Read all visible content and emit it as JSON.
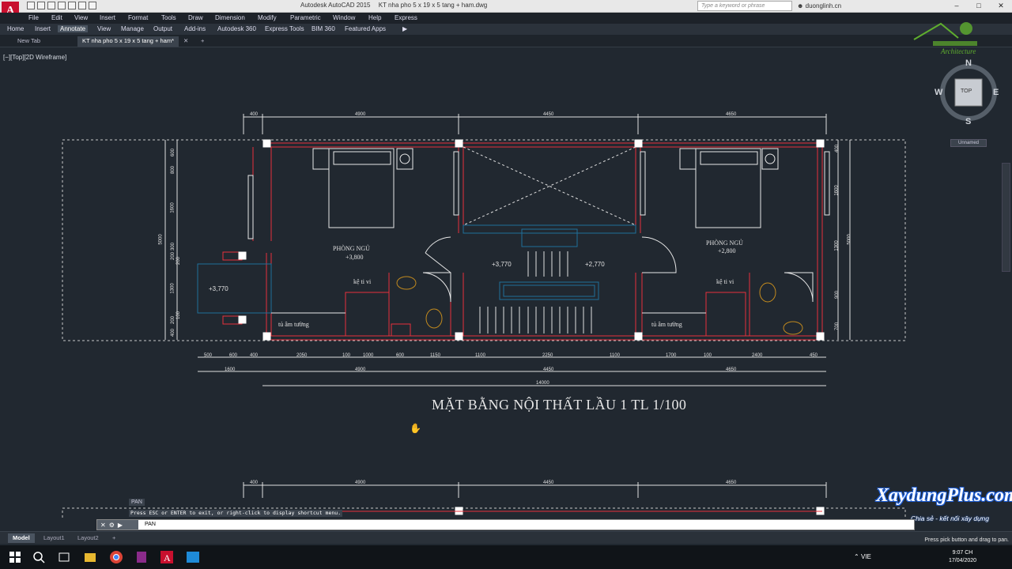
{
  "titlebar": {
    "app": "Autodesk AutoCAD 2015",
    "file": "KT nha pho 5 x 19 x 5 tang + ham.dwg",
    "search_placeholder": "Type a keyword or phrase",
    "user": "duonglinh.cn"
  },
  "app_logo": "A",
  "menu": [
    "File",
    "Edit",
    "View",
    "Insert",
    "Format",
    "Tools",
    "Draw",
    "Dimension",
    "Modify",
    "Parametric",
    "Window",
    "Help",
    "Express"
  ],
  "ribbon_tabs": [
    "Home",
    "Insert",
    "Annotate",
    "View",
    "Manage",
    "Output",
    "Add-ins",
    "Autodesk 360",
    "Express Tools",
    "BIM 360",
    "Featured Apps"
  ],
  "ribbon_active": "Annotate",
  "file_tabs": [
    "New Tab",
    "KT nha pho 5 x 19 x 5 tang + ham*"
  ],
  "viewport_label": "[−][Top][2D Wireframe]",
  "viewcube": {
    "north": "N",
    "south": "S",
    "east": "E",
    "west": "W",
    "face": "TOP",
    "ucs": "Unnamed"
  },
  "drawing": {
    "title": "MẶT BẰNG NỘI THẤT LẦU 1 TL 1/100",
    "rooms": {
      "bedroom_left": "PHÒNG NGỦ",
      "bedroom_left_level": "+3,800",
      "bedroom_right": "PHÒNG NGỦ",
      "bedroom_right_level": "+2,800",
      "balcony_level": "+3,770",
      "stair_level_left": "+3,770",
      "stair_level_right": "+2,770",
      "tv_shelf_left": "kệ ti vi",
      "tv_shelf_right": "kệ ti vi",
      "wardrobe_left": "tủ âm tường",
      "wardrobe_right": "tủ âm tường"
    },
    "dims_top": [
      "400",
      "4900",
      "4450",
      "4650"
    ],
    "dims_bottom_1": [
      "500",
      "600",
      "400",
      "2050",
      "100",
      "1000",
      "600",
      "1150",
      "1100",
      "2250",
      "1100",
      "1700",
      "100",
      "2400",
      "450"
    ],
    "dims_bottom_2": [
      "1600",
      "4900",
      "4450",
      "4650"
    ],
    "dims_bottom_total": "14000",
    "dims_left": [
      "600",
      "800",
      "1600",
      "5000",
      "300",
      "200",
      "200",
      "1300",
      "100",
      "200",
      "400"
    ],
    "dims_right": [
      "400",
      "1600",
      "1300",
      "5000",
      "900",
      "700"
    ],
    "dims_top_lower": [
      "400",
      "4900",
      "4450",
      "4650"
    ]
  },
  "watermark": {
    "brand": "XaydungPlus.com",
    "slogan": "Chia sẻ - kết nối xây dựng",
    "arch": "Architecture"
  },
  "command": {
    "tag": "PAN",
    "history": "Press ESC or ENTER to exit, or right-click to display shortcut menu.",
    "prompt": "PAN"
  },
  "layout_tabs": [
    "Model",
    "Layout1",
    "Layout2"
  ],
  "status_message": "Press pick button and drag to pan.",
  "taskbar": {
    "lang": "VIE",
    "time": "9:07 CH",
    "date": "17/04/2020"
  }
}
